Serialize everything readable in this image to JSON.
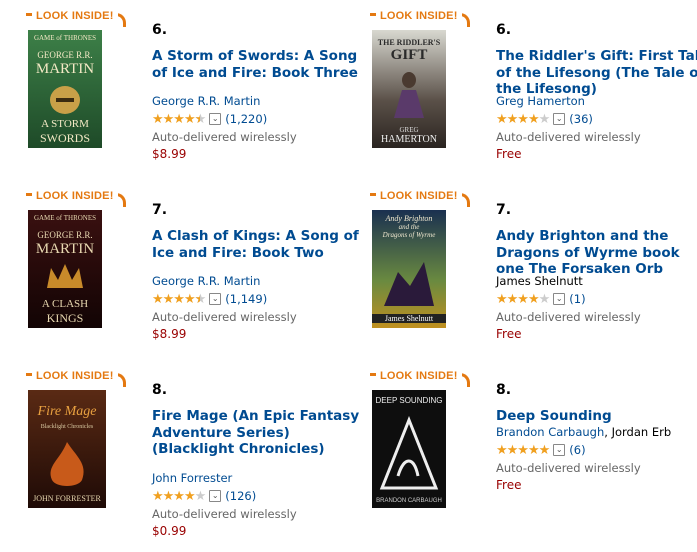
{
  "look_inside": "LOOK INSIDE!",
  "auto_label": "Auto-delivered wirelessly",
  "items": [
    {
      "rank": "6.",
      "title": "A Storm of Swords: A Song of Ice and Fire: Book Three",
      "author": "George R.R. Martin",
      "author2": "",
      "rating_stars": 4.5,
      "review_count": "(1,220)",
      "price": "$8.99",
      "cover_text": [
        "GAME of THRONES",
        "GEORGE R.R.",
        "MARTIN",
        "A STORM",
        "SWORDS"
      ],
      "cover_color": "#2e6a3a"
    },
    {
      "rank": "6.",
      "title": "The Riddler's Gift: First Tale of the Lifesong (The Tale of the Lifesong)",
      "author": "Greg Hamerton",
      "author2": "",
      "rating_stars": 4,
      "review_count": "(36)",
      "price": "Free",
      "cover_text": [
        "THE RIDDLER'S",
        "GIFT",
        "GREG",
        "HAMERTON"
      ],
      "cover_color": "#6a6a6a"
    },
    {
      "rank": "7.",
      "title": "A Clash of Kings: A Song of Ice and Fire: Book Two",
      "author": "George R.R. Martin",
      "author2": "",
      "rating_stars": 4.5,
      "review_count": "(1,149)",
      "price": "$8.99",
      "cover_text": [
        "GAME of THRONES",
        "GEORGE R.R.",
        "MARTIN",
        "A CLASH",
        "KINGS"
      ],
      "cover_color": "#2a0a0a"
    },
    {
      "rank": "7.",
      "title": "Andy Brighton and the Dragons of Wyrme book one The Forsaken Orb",
      "author": "James Shelnutt",
      "author2": "",
      "rating_stars": 4,
      "review_count": "(1)",
      "price": "Free",
      "cover_text": [
        "Andy Brighton",
        "and the",
        "Dragons of Wyrme",
        "James Shelnutt"
      ],
      "cover_color": "#3a5a7a"
    },
    {
      "rank": "8.",
      "title": "Fire Mage (An Epic Fantasy Adventure Series) (Blacklight Chronicles)",
      "author": "John Forrester",
      "author2": "",
      "rating_stars": 4,
      "review_count": "(126)",
      "price": "$0.99",
      "cover_text": [
        "Fire Mage",
        "Blacklight Chronicles",
        "JOHN FORRESTER"
      ],
      "cover_color": "#3a1a0e"
    },
    {
      "rank": "8.",
      "title": "Deep Sounding",
      "author": "Brandon Carbaugh",
      "author2": ", Jordan Erb",
      "rating_stars": 5,
      "review_count": "(6)",
      "price": "Free",
      "cover_text": [
        "DEEP SOUNDING",
        "BRANDON CARBAUGH"
      ],
      "cover_color": "#111111"
    }
  ]
}
